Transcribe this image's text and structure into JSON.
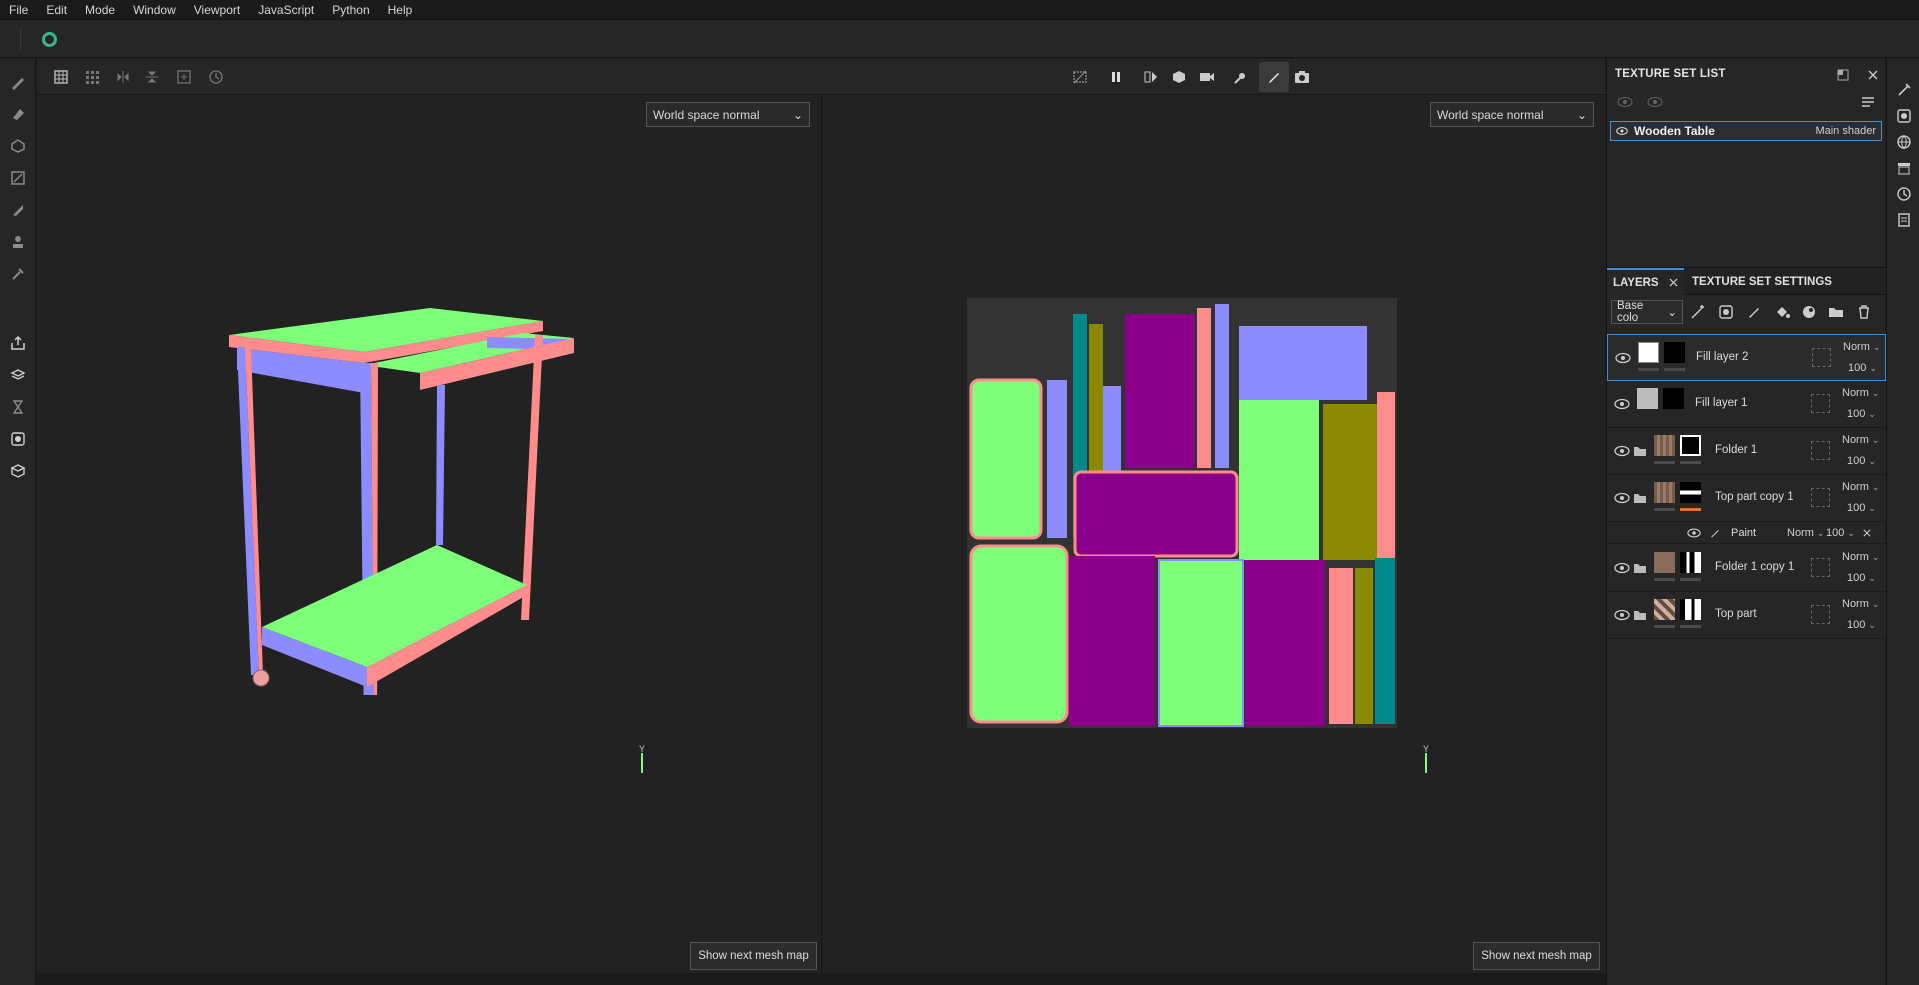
{
  "menu": [
    "File",
    "Edit",
    "Mode",
    "Window",
    "Viewport",
    "JavaScript",
    "Python",
    "Help"
  ],
  "viewport_left": {
    "mode": "World space normal",
    "next_btn": "Show next mesh map",
    "axis": "Y"
  },
  "viewport_right": {
    "mode": "World space normal",
    "next_btn": "Show next mesh map",
    "axis": "Y"
  },
  "texture_set_list": {
    "title": "TEXTURE SET LIST",
    "item": {
      "name": "Wooden Table",
      "shader": "Main shader"
    }
  },
  "tabs": {
    "layers": "LAYERS",
    "texture_set_settings": "TEXTURE SET SETTINGS"
  },
  "channel": "Base colo",
  "layers": [
    {
      "name": "Fill layer 2",
      "blend": "Norm",
      "opacity": "100",
      "selected": true
    },
    {
      "name": "Fill layer 1",
      "blend": "Norm",
      "opacity": "100"
    },
    {
      "name": "Folder 1",
      "blend": "Norm",
      "opacity": "100"
    },
    {
      "name": "Top part copy 1",
      "blend": "Norm",
      "opacity": "100"
    },
    {
      "name": "Folder 1 copy 1",
      "blend": "Norm",
      "opacity": "100"
    },
    {
      "name": "Top part",
      "blend": "Norm",
      "opacity": "100"
    }
  ],
  "paint_effect": {
    "name": "Paint",
    "blend": "Norm",
    "opacity": "100"
  },
  "colors": {
    "accent": "#3a8fdf",
    "normal_green": "#7dff7a",
    "normal_pink": "#ff8c8c",
    "normal_blue": "#8c8cff",
    "normal_purple": "#8a008a"
  }
}
